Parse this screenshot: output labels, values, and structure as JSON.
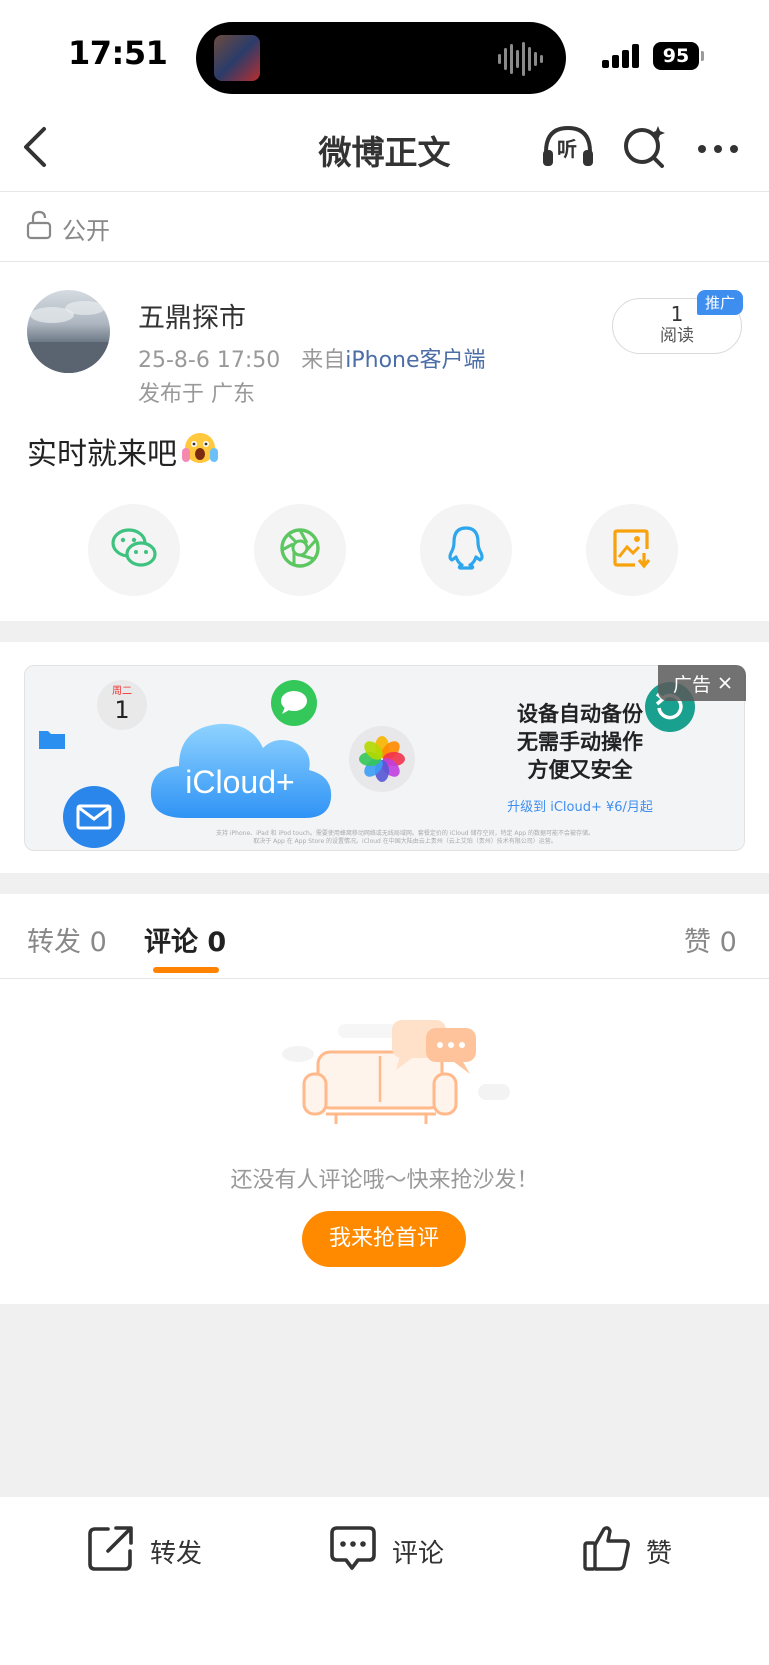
{
  "status_bar": {
    "time": "17:51",
    "battery": "95"
  },
  "nav": {
    "title": "微博正文",
    "listen_label": "听"
  },
  "visibility": {
    "label": "公开"
  },
  "post": {
    "author": "五鼎探市",
    "time": "25-8-6 17:50",
    "source_prefix": "来自",
    "source": "iPhone客户端",
    "location": "发布于 广东",
    "reads_count": "1",
    "reads_label": "阅读",
    "promo_tag": "推广",
    "text": "实时就来吧",
    "emoji": "scream-emoji"
  },
  "share": {
    "items": [
      {
        "icon": "wechat-icon",
        "color": "#3ec27f"
      },
      {
        "icon": "moments-icon",
        "color": "#5cc660"
      },
      {
        "icon": "qq-icon",
        "color": "#2ea6ee"
      },
      {
        "icon": "save-image-icon",
        "color": "#f8a20d"
      }
    ]
  },
  "ad": {
    "label": "广告",
    "calendar_day": "周二",
    "calendar_num": "1",
    "brand": "iCloud+",
    "headline_1": "设备自动备份",
    "headline_2": "无需手动操作",
    "headline_3": "方便又安全",
    "sub": "升级到 iCloud+ ¥6/月起",
    "fine_print_1": "支持 iPhone、iPad 和 iPod touch。需要使用蜂窝移动网络或无线局域网。套餐定价的 iCloud 储存空间，特定 App 的数据可能不会被存储。",
    "fine_print_2": "取决于 App 在 App Store 的设置情况。iCloud 在中国大陆由云上贵州（云上艾珀（贵州）技术有限公司）运营。"
  },
  "tabs": {
    "repost_label": "转发",
    "repost_count": "0",
    "comment_label": "评论",
    "comment_count": "0",
    "like_label": "赞",
    "like_count": "0"
  },
  "empty_state": {
    "message": "还没有人评论哦～快来抢沙发！",
    "button": "我来抢首评"
  },
  "bottom_bar": {
    "repost": "转发",
    "comment": "评论",
    "like": "赞"
  },
  "colors": {
    "accent": "#ff8200",
    "link": "#4b6ea7",
    "promo": "#3e8ef0"
  }
}
